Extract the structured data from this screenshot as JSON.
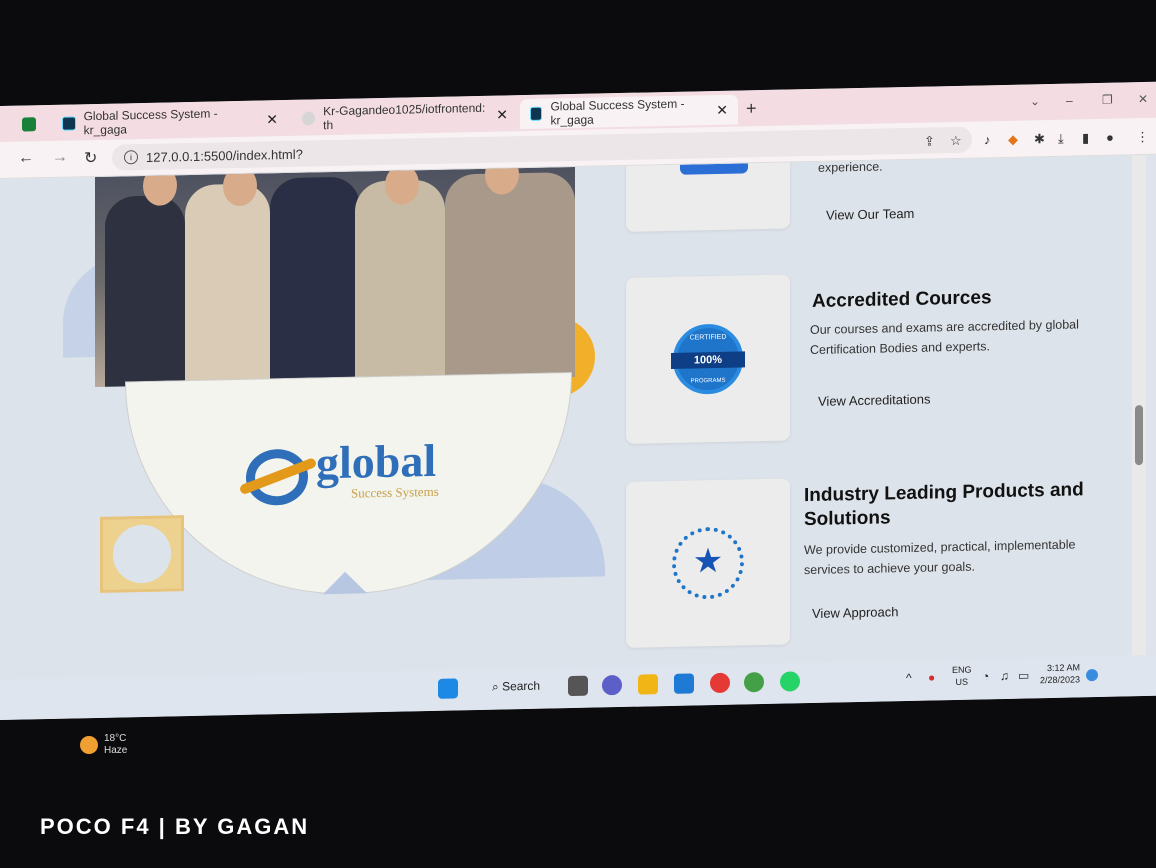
{
  "browser": {
    "tabs": [
      {
        "title": "Global Success System - kr_gaga",
        "active": false
      },
      {
        "title": "Kr-Gagandeo1025/iotfrontend: th",
        "active": false
      },
      {
        "title": "Global Success System - kr_gaga",
        "active": true
      }
    ],
    "new_tab": "+",
    "url": "127.0.0.1:5500/index.html?",
    "close": "✕"
  },
  "page": {
    "top_card": {
      "partial_text": "experience.",
      "link": "View Our Team"
    },
    "cards": [
      {
        "title": "Accredited Cources",
        "description": "Our courses and exams are accredited by global Certification Bodies and experts.",
        "link": "View Accreditations",
        "badge_top": "CERTIFIED",
        "badge_value": "100%",
        "badge_bottom": "PROGRAMS"
      },
      {
        "title": "Industry Leading Products and Solutions",
        "description": "We provide customized, practical, implementable services to achieve your goals.",
        "link": "View Approach"
      }
    ],
    "logo": {
      "name": "global",
      "tagline": "Success Systems"
    }
  },
  "taskbar": {
    "search": "Search",
    "lang_top": "ENG",
    "lang_bottom": "US",
    "time": "3:12 AM",
    "date": "2/28/2023",
    "weather_temp": "18°C",
    "weather_desc": "Haze"
  },
  "caption": "POCO F4 | BY GAGAN",
  "colors": {
    "accent": "#2f6eb8",
    "orange": "#e39a1a",
    "tab_strip": "#f3dde3"
  }
}
